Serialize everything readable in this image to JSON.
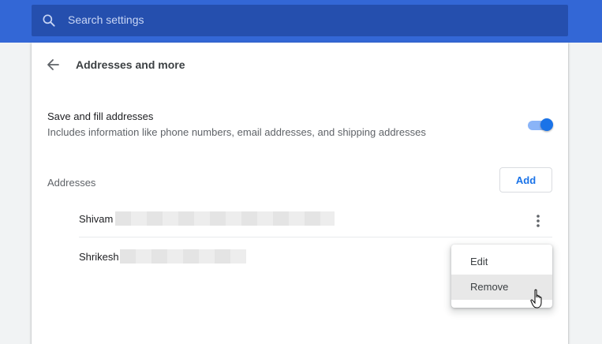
{
  "search": {
    "placeholder": "Search settings"
  },
  "page": {
    "title": "Addresses and more"
  },
  "setting": {
    "title": "Save and fill addresses",
    "subtitle": "Includes information like phone numbers, email addresses, and shipping addresses",
    "enabled": true
  },
  "addresses": {
    "label": "Addresses",
    "add_label": "Add",
    "items": [
      {
        "name": "Shivam"
      },
      {
        "name": "Shrikesh"
      }
    ]
  },
  "menu": {
    "items": [
      "Edit",
      "Remove"
    ],
    "hovered": "Remove"
  },
  "colors": {
    "header": "#3367d6",
    "search_bg": "#254fae",
    "accent": "#1a73e8",
    "toggle_track": "#8ab4f8"
  },
  "icons": [
    "search-icon",
    "back-arrow-icon",
    "more-vert-icon",
    "hand-pointer-icon"
  ]
}
